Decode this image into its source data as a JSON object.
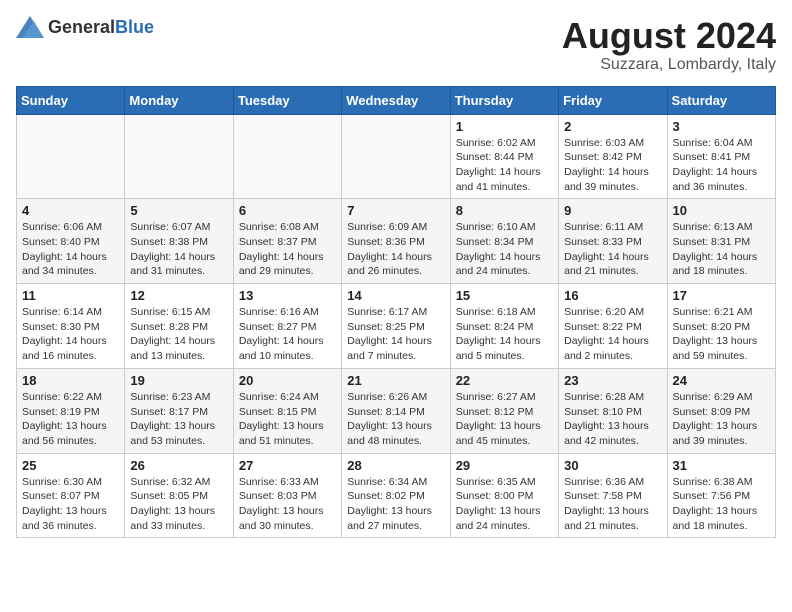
{
  "header": {
    "logo": {
      "general": "General",
      "blue": "Blue"
    },
    "title": "August 2024",
    "location": "Suzzara, Lombardy, Italy"
  },
  "weekdays": [
    "Sunday",
    "Monday",
    "Tuesday",
    "Wednesday",
    "Thursday",
    "Friday",
    "Saturday"
  ],
  "weeks": [
    [
      {
        "day": "",
        "info": ""
      },
      {
        "day": "",
        "info": ""
      },
      {
        "day": "",
        "info": ""
      },
      {
        "day": "",
        "info": ""
      },
      {
        "day": "1",
        "info": "Sunrise: 6:02 AM\nSunset: 8:44 PM\nDaylight: 14 hours\nand 41 minutes."
      },
      {
        "day": "2",
        "info": "Sunrise: 6:03 AM\nSunset: 8:42 PM\nDaylight: 14 hours\nand 39 minutes."
      },
      {
        "day": "3",
        "info": "Sunrise: 6:04 AM\nSunset: 8:41 PM\nDaylight: 14 hours\nand 36 minutes."
      }
    ],
    [
      {
        "day": "4",
        "info": "Sunrise: 6:06 AM\nSunset: 8:40 PM\nDaylight: 14 hours\nand 34 minutes."
      },
      {
        "day": "5",
        "info": "Sunrise: 6:07 AM\nSunset: 8:38 PM\nDaylight: 14 hours\nand 31 minutes."
      },
      {
        "day": "6",
        "info": "Sunrise: 6:08 AM\nSunset: 8:37 PM\nDaylight: 14 hours\nand 29 minutes."
      },
      {
        "day": "7",
        "info": "Sunrise: 6:09 AM\nSunset: 8:36 PM\nDaylight: 14 hours\nand 26 minutes."
      },
      {
        "day": "8",
        "info": "Sunrise: 6:10 AM\nSunset: 8:34 PM\nDaylight: 14 hours\nand 24 minutes."
      },
      {
        "day": "9",
        "info": "Sunrise: 6:11 AM\nSunset: 8:33 PM\nDaylight: 14 hours\nand 21 minutes."
      },
      {
        "day": "10",
        "info": "Sunrise: 6:13 AM\nSunset: 8:31 PM\nDaylight: 14 hours\nand 18 minutes."
      }
    ],
    [
      {
        "day": "11",
        "info": "Sunrise: 6:14 AM\nSunset: 8:30 PM\nDaylight: 14 hours\nand 16 minutes."
      },
      {
        "day": "12",
        "info": "Sunrise: 6:15 AM\nSunset: 8:28 PM\nDaylight: 14 hours\nand 13 minutes."
      },
      {
        "day": "13",
        "info": "Sunrise: 6:16 AM\nSunset: 8:27 PM\nDaylight: 14 hours\nand 10 minutes."
      },
      {
        "day": "14",
        "info": "Sunrise: 6:17 AM\nSunset: 8:25 PM\nDaylight: 14 hours\nand 7 minutes."
      },
      {
        "day": "15",
        "info": "Sunrise: 6:18 AM\nSunset: 8:24 PM\nDaylight: 14 hours\nand 5 minutes."
      },
      {
        "day": "16",
        "info": "Sunrise: 6:20 AM\nSunset: 8:22 PM\nDaylight: 14 hours\nand 2 minutes."
      },
      {
        "day": "17",
        "info": "Sunrise: 6:21 AM\nSunset: 8:20 PM\nDaylight: 13 hours\nand 59 minutes."
      }
    ],
    [
      {
        "day": "18",
        "info": "Sunrise: 6:22 AM\nSunset: 8:19 PM\nDaylight: 13 hours\nand 56 minutes."
      },
      {
        "day": "19",
        "info": "Sunrise: 6:23 AM\nSunset: 8:17 PM\nDaylight: 13 hours\nand 53 minutes."
      },
      {
        "day": "20",
        "info": "Sunrise: 6:24 AM\nSunset: 8:15 PM\nDaylight: 13 hours\nand 51 minutes."
      },
      {
        "day": "21",
        "info": "Sunrise: 6:26 AM\nSunset: 8:14 PM\nDaylight: 13 hours\nand 48 minutes."
      },
      {
        "day": "22",
        "info": "Sunrise: 6:27 AM\nSunset: 8:12 PM\nDaylight: 13 hours\nand 45 minutes."
      },
      {
        "day": "23",
        "info": "Sunrise: 6:28 AM\nSunset: 8:10 PM\nDaylight: 13 hours\nand 42 minutes."
      },
      {
        "day": "24",
        "info": "Sunrise: 6:29 AM\nSunset: 8:09 PM\nDaylight: 13 hours\nand 39 minutes."
      }
    ],
    [
      {
        "day": "25",
        "info": "Sunrise: 6:30 AM\nSunset: 8:07 PM\nDaylight: 13 hours\nand 36 minutes."
      },
      {
        "day": "26",
        "info": "Sunrise: 6:32 AM\nSunset: 8:05 PM\nDaylight: 13 hours\nand 33 minutes."
      },
      {
        "day": "27",
        "info": "Sunrise: 6:33 AM\nSunset: 8:03 PM\nDaylight: 13 hours\nand 30 minutes."
      },
      {
        "day": "28",
        "info": "Sunrise: 6:34 AM\nSunset: 8:02 PM\nDaylight: 13 hours\nand 27 minutes."
      },
      {
        "day": "29",
        "info": "Sunrise: 6:35 AM\nSunset: 8:00 PM\nDaylight: 13 hours\nand 24 minutes."
      },
      {
        "day": "30",
        "info": "Sunrise: 6:36 AM\nSunset: 7:58 PM\nDaylight: 13 hours\nand 21 minutes."
      },
      {
        "day": "31",
        "info": "Sunrise: 6:38 AM\nSunset: 7:56 PM\nDaylight: 13 hours\nand 18 minutes."
      }
    ]
  ]
}
